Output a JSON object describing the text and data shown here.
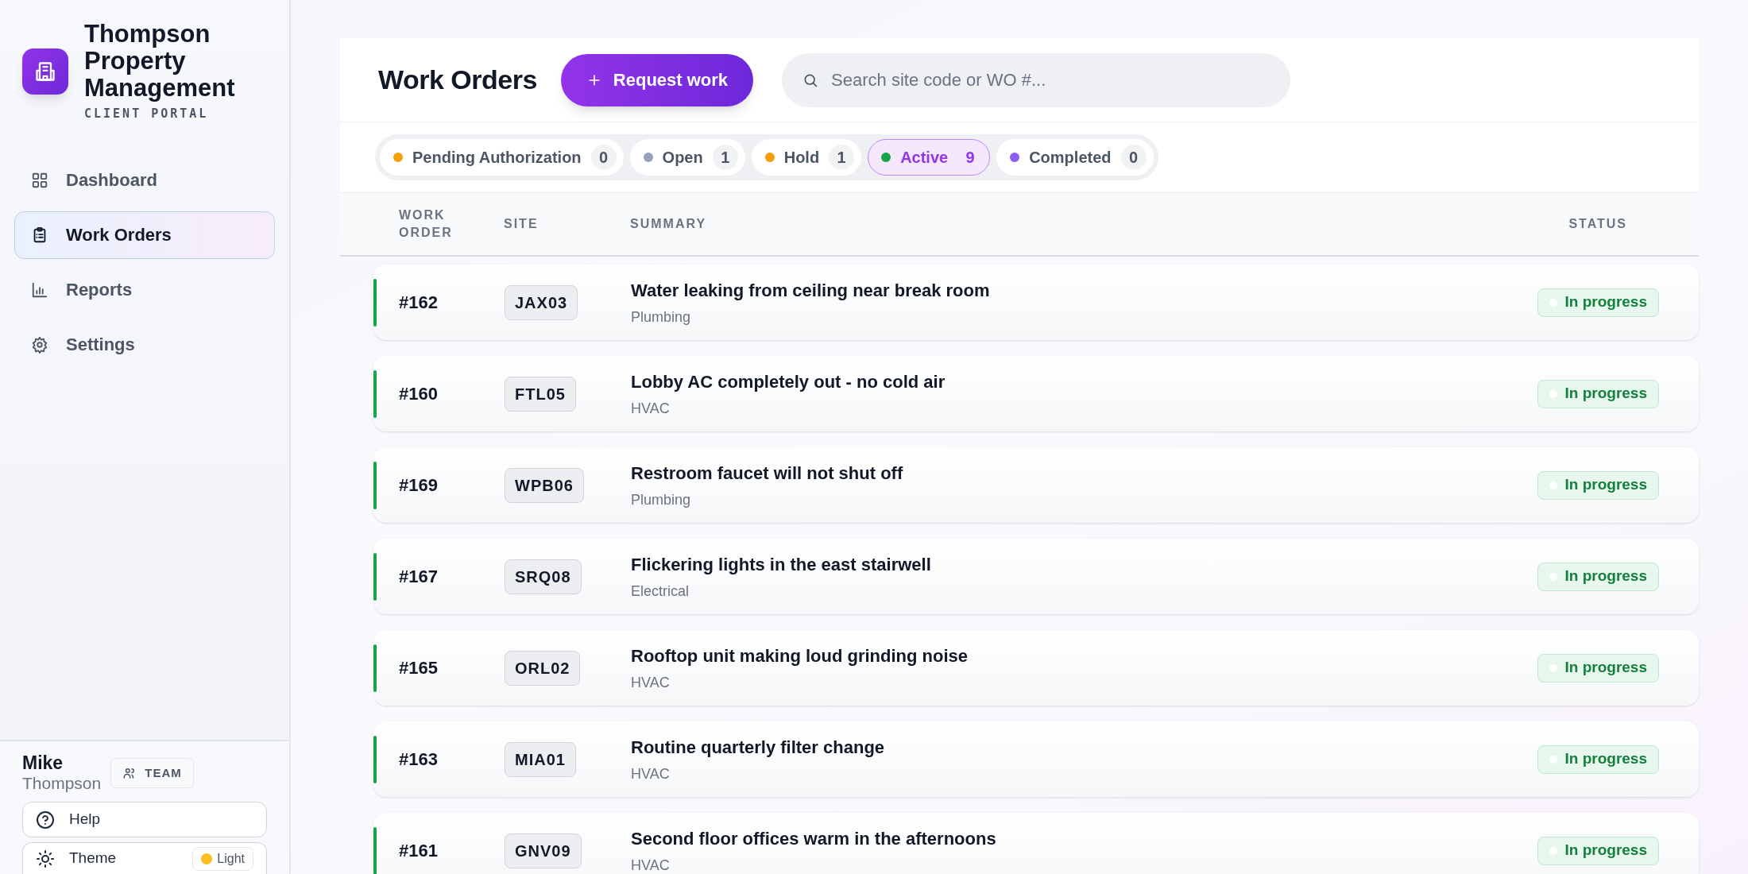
{
  "sidebar": {
    "brand": {
      "name": "Thompson Property Management",
      "subtitle": "CLIENT PORTAL"
    },
    "nav": [
      {
        "label": "Dashboard",
        "selected": false
      },
      {
        "label": "Work Orders",
        "selected": true
      },
      {
        "label": "Reports",
        "selected": false
      },
      {
        "label": "Settings",
        "selected": false
      }
    ],
    "user": {
      "first_name": "Mike",
      "last_name": "Thompson",
      "role": "TEAM"
    },
    "help": "Help",
    "theme": {
      "label": "Theme",
      "value": "Light"
    }
  },
  "header": {
    "title": "Work Orders",
    "request_button": "Request work",
    "search": {
      "placeholder": "Search site code or WO #..."
    }
  },
  "filters": [
    {
      "label": "Pending Authorization",
      "count": "0",
      "color": "#f59e0b",
      "selected": false
    },
    {
      "label": "Open",
      "count": "1",
      "color": "#94a3b8",
      "selected": false
    },
    {
      "label": "Hold",
      "count": "1",
      "color": "#f59e0b",
      "selected": false
    },
    {
      "label": "Active",
      "count": "9",
      "color": "#16a34a",
      "selected": true
    },
    {
      "label": "Completed",
      "count": "0",
      "color": "#8b5cf6",
      "selected": false
    }
  ],
  "table": {
    "columns": [
      "WORK ORDER",
      "SITE",
      "SUMMARY",
      "STATUS"
    ],
    "rows": [
      {
        "number": "#162",
        "site": "JAX03",
        "summary": "Water leaking from ceiling near break room",
        "category": "Plumbing",
        "status": "In progress",
        "kind": "in_progress"
      },
      {
        "number": "#160",
        "site": "FTL05",
        "summary": "Lobby AC completely out - no cold air",
        "category": "HVAC",
        "status": "In progress",
        "kind": "in_progress"
      },
      {
        "number": "#169",
        "site": "WPB06",
        "summary": "Restroom faucet will not shut off",
        "category": "Plumbing",
        "status": "In progress",
        "kind": "in_progress"
      },
      {
        "number": "#167",
        "site": "SRQ08",
        "summary": "Flickering lights in the east stairwell",
        "category": "Electrical",
        "status": "In progress",
        "kind": "in_progress"
      },
      {
        "number": "#165",
        "site": "ORL02",
        "summary": "Rooftop unit making loud grinding noise",
        "category": "HVAC",
        "status": "In progress",
        "kind": "in_progress"
      },
      {
        "number": "#163",
        "site": "MIA01",
        "summary": "Routine quarterly filter change",
        "category": "HVAC",
        "status": "In progress",
        "kind": "in_progress"
      },
      {
        "number": "#161",
        "site": "GNV09",
        "summary": "Second floor offices warm in the afternoons",
        "category": "HVAC",
        "status": "In progress",
        "kind": "in_progress"
      }
    ]
  }
}
